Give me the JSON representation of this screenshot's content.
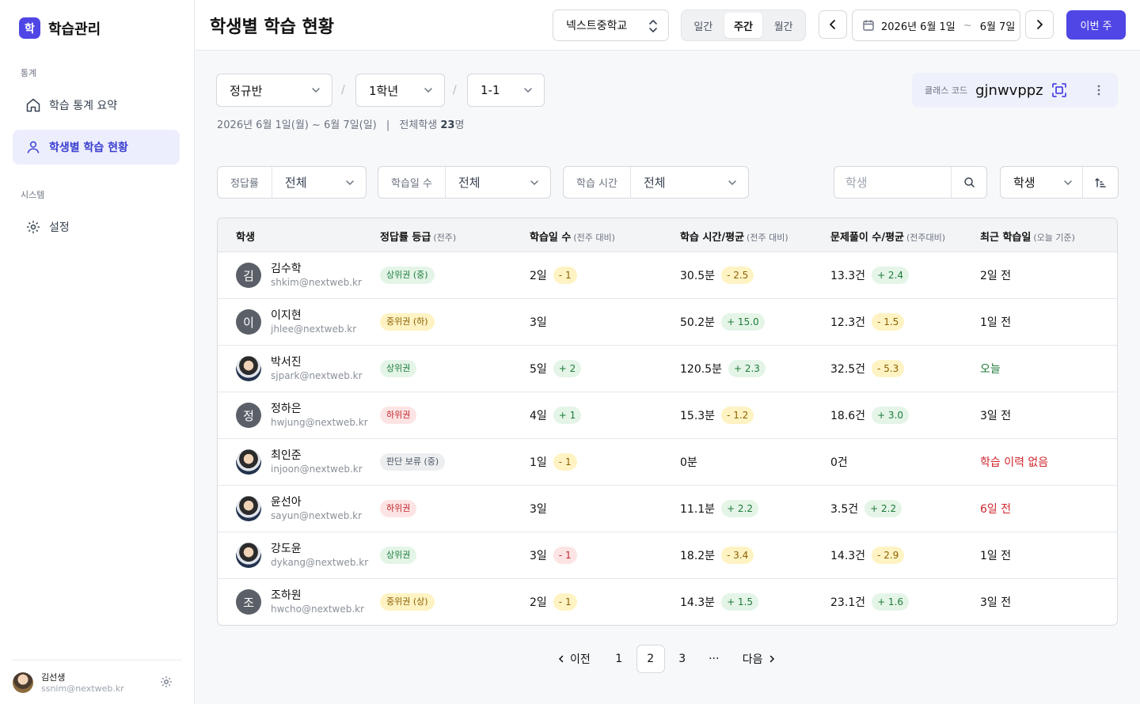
{
  "brand": {
    "logo": "학",
    "name": "학습관리"
  },
  "nav": {
    "section_stats": "통계",
    "items_stats": [
      {
        "label": "학습 통계 요약",
        "icon": "home-icon"
      },
      {
        "label": "학생별 학습 현황",
        "icon": "user-icon",
        "active": true
      }
    ],
    "section_system": "시스템",
    "items_system": [
      {
        "label": "설정",
        "icon": "gear-icon"
      }
    ]
  },
  "user": {
    "name": "김선생",
    "email": "ssnim@nextweb.kr"
  },
  "header": {
    "title": "학생별 학습 현황",
    "school": "넥스트중학교",
    "period_tabs": [
      "일간",
      "주간",
      "월간"
    ],
    "active_period": "주간",
    "date_start": "2026년 6월 1일",
    "date_sep": "~",
    "date_end": "6월 7일",
    "this_week": "이번 주"
  },
  "filters_top": {
    "class_type": "정규반",
    "grade": "1학년",
    "class": "1-1",
    "separator": "/"
  },
  "summary": {
    "range": "2026년 6월 1일(월) ~ 6월 7일(일)",
    "divider": "|",
    "total_label": "전체학생",
    "total_count": "23",
    "unit": "명"
  },
  "class_code": {
    "label": "클래스 코드",
    "value": "gjnwvppz"
  },
  "filters": [
    {
      "label": "정답률",
      "value": "전체"
    },
    {
      "label": "학습일 수",
      "value": "전체"
    },
    {
      "label": "학습 시간",
      "value": "전체"
    }
  ],
  "search": {
    "placeholder": "학생"
  },
  "sort": {
    "value": "학생"
  },
  "table": {
    "headers": [
      {
        "title": "학생",
        "sub": ""
      },
      {
        "title": "정답률 등급",
        "sub": "(전주)"
      },
      {
        "title": "학습일 수",
        "sub": "(전주 대비)"
      },
      {
        "title": "학습 시간/평균",
        "sub": "(전주 대비)"
      },
      {
        "title": "문제풀이 수/평균",
        "sub": "(전주대비)"
      },
      {
        "title": "최근 학습일",
        "sub": "(오늘 기준)"
      }
    ],
    "rows": [
      {
        "initial": "김",
        "photo": false,
        "name": "김수학",
        "email": "shkim@nextweb.kr",
        "grade": "상위권 (중)",
        "grade_color": "green",
        "days": "2일",
        "days_delta": "- 1",
        "days_delta_color": "yellow",
        "time": "30.5분",
        "time_delta": "- 2.5",
        "time_delta_color": "yellow",
        "problems": "13.3건",
        "prob_delta": "+ 2.4",
        "prob_delta_color": "green",
        "recent": "2일 전",
        "recent_color": "default"
      },
      {
        "initial": "이",
        "photo": false,
        "name": "이지현",
        "email": "jhlee@nextweb.kr",
        "grade": "중위권 (하)",
        "grade_color": "yellow",
        "days": "3일",
        "days_delta": "",
        "days_delta_color": "",
        "time": "50.2분",
        "time_delta": "+ 15.0",
        "time_delta_color": "green",
        "problems": "12.3건",
        "prob_delta": "- 1.5",
        "prob_delta_color": "yellow",
        "recent": "1일 전",
        "recent_color": "default"
      },
      {
        "initial": "",
        "photo": true,
        "name": "박서진",
        "email": "sjpark@nextweb.kr",
        "grade": "상위권",
        "grade_color": "green",
        "days": "5일",
        "days_delta": "+ 2",
        "days_delta_color": "green",
        "time": "120.5분",
        "time_delta": "+ 2.3",
        "time_delta_color": "green",
        "problems": "32.5건",
        "prob_delta": "- 5.3",
        "prob_delta_color": "yellow",
        "recent": "오늘",
        "recent_color": "green"
      },
      {
        "initial": "정",
        "photo": false,
        "name": "정하은",
        "email": "hwjung@nextweb.kr",
        "grade": "하위권",
        "grade_color": "red",
        "days": "4일",
        "days_delta": "+ 1",
        "days_delta_color": "green",
        "time": "15.3분",
        "time_delta": "- 1.2",
        "time_delta_color": "yellow",
        "problems": "18.6건",
        "prob_delta": "+ 3.0",
        "prob_delta_color": "green",
        "recent": "3일 전",
        "recent_color": "default"
      },
      {
        "initial": "",
        "photo": true,
        "name": "최인준",
        "email": "injoon@nextweb.kr",
        "grade": "판단 보류 (중)",
        "grade_color": "gray",
        "days": "1일",
        "days_delta": "- 1",
        "days_delta_color": "yellow",
        "time": "0분",
        "time_delta": "",
        "time_delta_color": "",
        "problems": "0건",
        "prob_delta": "",
        "prob_delta_color": "",
        "recent": "학습 이력 없음",
        "recent_color": "red"
      },
      {
        "initial": "",
        "photo": true,
        "name": "윤선아",
        "email": "sayun@nextweb.kr",
        "grade": "하위권",
        "grade_color": "red",
        "days": "3일",
        "days_delta": "",
        "days_delta_color": "",
        "time": "11.1분",
        "time_delta": "+ 2.2",
        "time_delta_color": "green",
        "problems": "3.5건",
        "prob_delta": "+ 2.2",
        "prob_delta_color": "green",
        "recent": "6일 전",
        "recent_color": "red"
      },
      {
        "initial": "",
        "photo": true,
        "name": "강도윤",
        "email": "dykang@nextweb.kr",
        "grade": "상위권",
        "grade_color": "green",
        "days": "3일",
        "days_delta": "- 1",
        "days_delta_color": "red",
        "time": "18.2분",
        "time_delta": "- 3.4",
        "time_delta_color": "yellow",
        "problems": "14.3건",
        "prob_delta": "- 2.9",
        "prob_delta_color": "yellow",
        "recent": "1일 전",
        "recent_color": "default"
      },
      {
        "initial": "조",
        "photo": false,
        "name": "조하원",
        "email": "hwcho@nextweb.kr",
        "grade": "중위권 (상)",
        "grade_color": "yellow",
        "days": "2일",
        "days_delta": "- 1",
        "days_delta_color": "yellow",
        "time": "14.3분",
        "time_delta": "+ 1.5",
        "time_delta_color": "green",
        "problems": "23.1건",
        "prob_delta": "+ 1.6",
        "prob_delta_color": "green",
        "recent": "3일 전",
        "recent_color": "default"
      }
    ]
  },
  "pagination": {
    "prev": "이전",
    "pages": [
      "1",
      "2",
      "3"
    ],
    "current": "2",
    "ellipsis": "···",
    "next": "다음"
  },
  "colors": {
    "accent": "#4f46e5",
    "active_nav_bg": "#eceefe"
  }
}
